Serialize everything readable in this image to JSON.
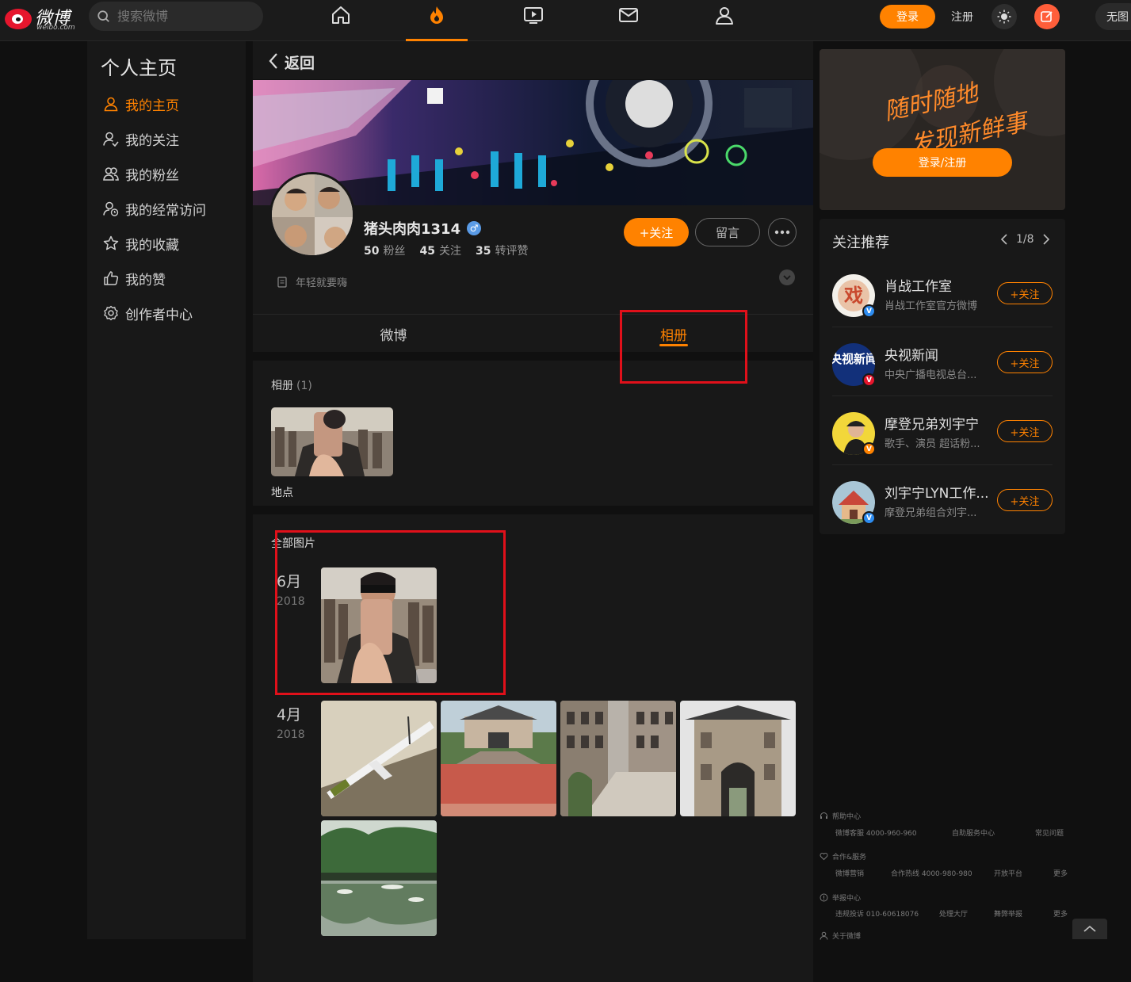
{
  "header": {
    "logo_text": "微博",
    "logo_sub": "weibo.com",
    "search_placeholder": "搜索微博",
    "login_label": "登录",
    "register_label": "注册",
    "no_image_label": "无图"
  },
  "sidebar": {
    "title": "个人主页",
    "items": [
      {
        "label": "我的主页",
        "icon": "user-icon"
      },
      {
        "label": "我的关注",
        "icon": "user-plus-icon"
      },
      {
        "label": "我的粉丝",
        "icon": "users-icon"
      },
      {
        "label": "我的经常访问",
        "icon": "user-clock-icon"
      },
      {
        "label": "我的收藏",
        "icon": "star-icon"
      },
      {
        "label": "我的赞",
        "icon": "thumbs-up-icon"
      },
      {
        "label": "创作者中心",
        "icon": "gear-icon"
      }
    ]
  },
  "main": {
    "back_label": "返回",
    "profile": {
      "name": "猪头肉肉1314",
      "gender_symbol": "♂",
      "followers": "50",
      "followers_label": "粉丝",
      "following": "45",
      "following_label": "关注",
      "reposts": "35",
      "reposts_label": "转评赞",
      "bio": "年轻就要嗨",
      "follow_label": "+关注",
      "message_label": "留言"
    },
    "tabs": [
      {
        "label": "微博"
      },
      {
        "label": "相册"
      }
    ],
    "albums": {
      "heading": "相册",
      "count": "(1)",
      "album_name": "地点"
    },
    "all_pictures": {
      "heading": "全部图片",
      "groups": [
        {
          "month": "6月",
          "year": "2018"
        },
        {
          "month": "4月",
          "year": "2018"
        }
      ]
    }
  },
  "right": {
    "promo_line1": "随时随地",
    "promo_line2": "发现新鲜事",
    "promo_button": "登录/注册",
    "recommend_title": "关注推荐",
    "pager": "1/8",
    "recommendations": [
      {
        "name": "肖战工作室",
        "desc": "肖战工作室官方微博",
        "badge": "V",
        "badge_color": "#2d8cf0",
        "avatar_text": "戏"
      },
      {
        "name": "央视新闻",
        "desc": "中央广播电视总台...",
        "badge": "V",
        "badge_color": "#e6162d",
        "avatar_text": "央视新闻"
      },
      {
        "name": "摩登兄弟刘宇宁",
        "desc": "歌手、演员 超话粉...",
        "badge": "V",
        "badge_color": "#ff8200",
        "avatar_text": ""
      },
      {
        "name": "刘宇宁LYN工作...",
        "desc": "摩登兄弟组合刘宇...",
        "badge": "V",
        "badge_color": "#2d8cf0",
        "avatar_text": ""
      }
    ],
    "follow_label": "+关注"
  },
  "footer": {
    "help_title": "帮助中心",
    "help_links": [
      "微博客服 4000-960-960",
      "自助服务中心",
      "常见问题"
    ],
    "coop_title": "合作&服务",
    "coop_links": [
      "微博营销",
      "合作热线 4000-980-980",
      "开放平台",
      "更多"
    ],
    "report_title": "举报中心",
    "report_links": [
      "违规投诉 010-60618076",
      "处理大厅",
      "舞弊举报",
      "更多"
    ],
    "about_title": "关于微博"
  },
  "colors": {
    "accent": "#ff8200",
    "highlight_box": "#e0101a"
  }
}
